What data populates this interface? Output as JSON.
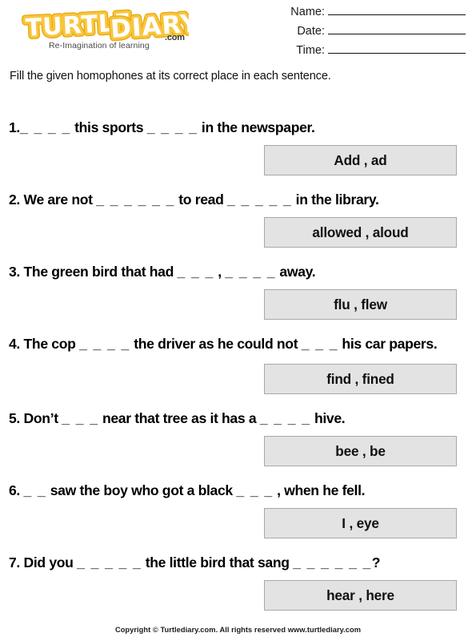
{
  "brand": {
    "logo_text_1": "TURTLE",
    "logo_text_2": "DIARY",
    "dotcom": ".com",
    "tagline": "Re-Imagination of learning",
    "logo_fill": "#ffffff",
    "logo_outline": "#f6bb25",
    "logo_outline_dark": "#e8a711"
  },
  "header": {
    "fields": [
      {
        "label": "Name:"
      },
      {
        "label": "Date:"
      },
      {
        "label": "Time:"
      }
    ]
  },
  "instruction": "Fill the given homophones at its correct place in each sentence.",
  "questions": [
    {
      "number": "1.",
      "pre": "",
      "blank1": "_ _ _ _",
      "mid": " this sports ",
      "blank2": "_ _ _ _",
      "post": " in the newspaper.",
      "answer": "Add  , ad"
    },
    {
      "number": "2.",
      "pre": " We are not ",
      "blank1": "_ _ _ _ _ _",
      "mid": " to read ",
      "blank2": "_ _ _ _ _",
      "post": " in the library.",
      "answer": "allowed , aloud"
    },
    {
      "number": "3.",
      "pre": " The green bird that had ",
      "blank1": "_ _ _",
      "mid": " , ",
      "blank2": "_ _ _ _",
      "post": "  away.",
      "answer": "flu , flew"
    },
    {
      "number": "4.",
      "pre": " The cop ",
      "blank1": "_ _ _ _",
      "mid": "  the driver as he could not ",
      "blank2": "_ _ _",
      "post": " his car papers.",
      "answer": "find , fined"
    },
    {
      "number": "5.",
      "pre": " Don’t ",
      "blank1": "_ _ _",
      "mid": " near that tree as it has a ",
      "blank2": "_ _ _ _",
      "post": " hive.",
      "answer": "bee , be"
    },
    {
      "number": "6.",
      "pre": " ",
      "blank1": "_ _",
      "mid": " saw the boy who got a black ",
      "blank2": "_ _ _",
      "post": " , when he fell.",
      "answer": "I , eye"
    },
    {
      "number": "7.",
      "pre": " Did you ",
      "blank1": "_ _ _ _ _",
      "mid": " the little bird that sang ",
      "blank2": "_ _ _ _ _ _",
      "post": "?",
      "answer": "hear , here"
    }
  ],
  "footer": "Copyright © Turtlediary.com. All rights reserved  www.turtlediary.com"
}
